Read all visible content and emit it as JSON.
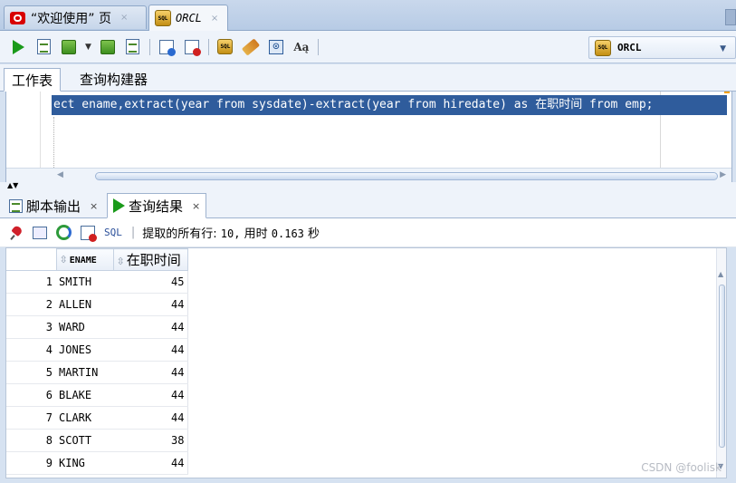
{
  "doc_tabs": [
    {
      "label": "“欢迎使用” 页",
      "close": "×"
    },
    {
      "label": "ORCL",
      "close": "×"
    }
  ],
  "icons": {
    "db_icon_text": "SQL"
  },
  "connection": {
    "label": "ORCL"
  },
  "sub_tabs": [
    {
      "label": "工作表"
    },
    {
      "label": "查询构建器"
    }
  ],
  "editor": {
    "sql_part1": "ect ename,extract(year from sysdate)-extract(year from hiredate) as ",
    "sql_alias": "在职时间",
    "sql_part2": " from emp;"
  },
  "result_tabs": [
    {
      "label": "脚本输出",
      "close": "×"
    },
    {
      "label": "查询结果",
      "close": "×"
    }
  ],
  "result_toolbar": {
    "sql_link": "SQL",
    "separator": "|",
    "status_prefix": "提取的所有行:",
    "rows": "10,",
    "time_label": "用时",
    "seconds": "0.163",
    "seconds_unit": "秒"
  },
  "grid": {
    "columns": [
      "ENAME",
      "在职时间"
    ],
    "rows": [
      {
        "n": "1",
        "ename": "SMITH",
        "years": "45"
      },
      {
        "n": "2",
        "ename": "ALLEN",
        "years": "44"
      },
      {
        "n": "3",
        "ename": "WARD",
        "years": "44"
      },
      {
        "n": "4",
        "ename": "JONES",
        "years": "44"
      },
      {
        "n": "5",
        "ename": "MARTIN",
        "years": "44"
      },
      {
        "n": "6",
        "ename": "BLAKE",
        "years": "44"
      },
      {
        "n": "7",
        "ename": "CLARK",
        "years": "44"
      },
      {
        "n": "8",
        "ename": "SCOTT",
        "years": "38"
      },
      {
        "n": "9",
        "ename": "KING",
        "years": "44"
      }
    ]
  },
  "watermark": "CSDN @foolisk",
  "colors": {
    "selection": "#2f5c9c",
    "run_green": "#1a9a1a",
    "oracle_red": "#d80000"
  }
}
